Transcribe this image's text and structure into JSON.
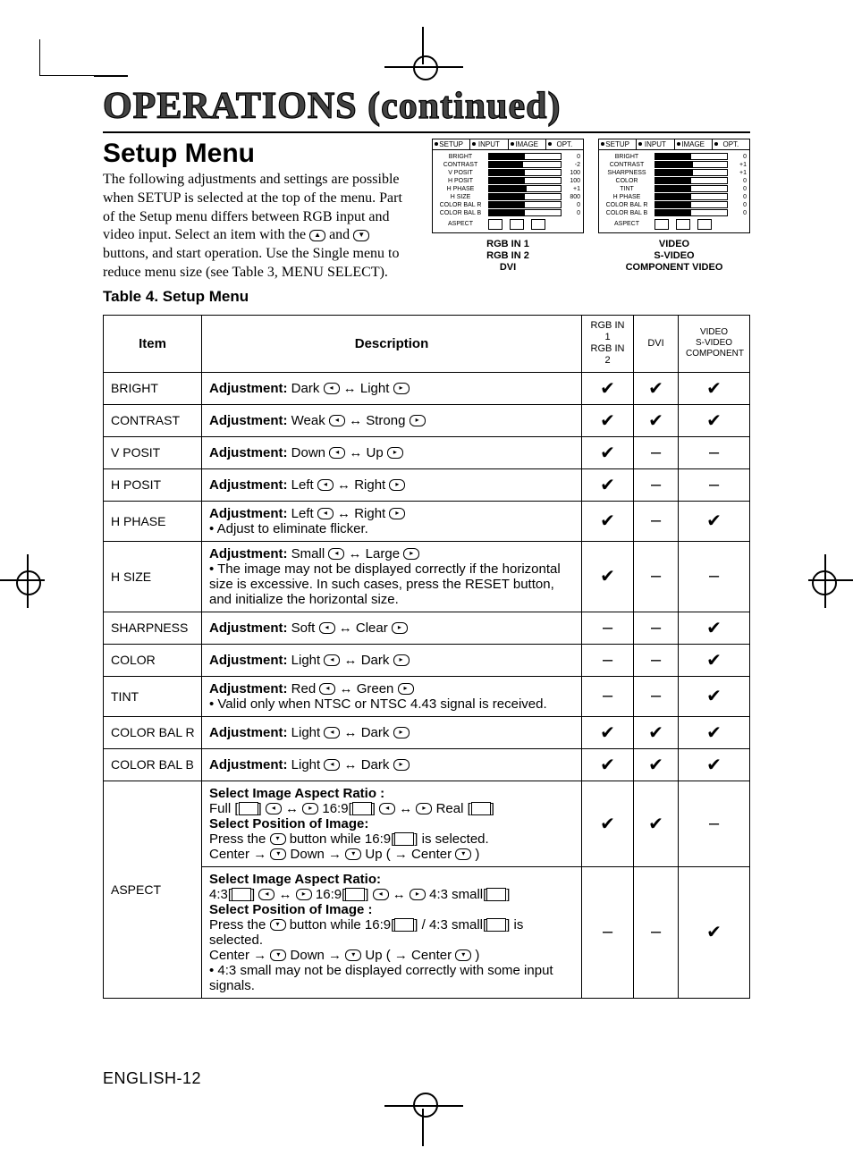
{
  "page_title": "OPERATIONS (continued)",
  "section_title": "Setup Menu",
  "intro": "The following adjustments and settings are possible when SETUP is selected at the top of the menu. Part of the Setup menu differs between RGB input and video input. Select an item with the Ⓐ and Ⓑ buttons, and start operation. Use the Single menu to reduce menu size (see Table 3, MENU SELECT).",
  "intro_pre": "The following adjustments and settings are possible when SETUP is selected at the top of the menu. Part of the Setup menu differs between RGB input and video input. Select an item with the ",
  "intro_mid": " and ",
  "intro_post": " buttons, and start operation. Use the Single menu to reduce menu size (see Table 3, MENU SELECT).",
  "table_caption": "Table 4. Setup Menu",
  "osd_tabs": [
    "SETUP",
    "INPUT",
    "IMAGE",
    "OPT."
  ],
  "osd_rgb": {
    "rows": [
      {
        "label": "BRIGHT",
        "fill": 50,
        "val": "0"
      },
      {
        "label": "CONTRAST",
        "fill": 48,
        "val": "-2"
      },
      {
        "label": "V POSIT",
        "fill": 50,
        "val": "100"
      },
      {
        "label": "H POSIT",
        "fill": 50,
        "val": "100"
      },
      {
        "label": "H PHASE",
        "fill": 52,
        "val": "+1"
      },
      {
        "label": "H SIZE",
        "fill": 50,
        "val": "800"
      },
      {
        "label": "COLOR BAL R",
        "fill": 50,
        "val": "0"
      },
      {
        "label": "COLOR BAL B",
        "fill": 50,
        "val": "0"
      }
    ],
    "aspect": "ASPECT",
    "caption": "RGB IN 1\nRGB IN 2\nDVI"
  },
  "osd_vid": {
    "rows": [
      {
        "label": "BRIGHT",
        "fill": 50,
        "val": "0"
      },
      {
        "label": "CONTRAST",
        "fill": 52,
        "val": "+1"
      },
      {
        "label": "SHARPNESS",
        "fill": 52,
        "val": "+1"
      },
      {
        "label": "COLOR",
        "fill": 50,
        "val": "0"
      },
      {
        "label": "TINT",
        "fill": 50,
        "val": "0"
      },
      {
        "label": "H PHASE",
        "fill": 50,
        "val": "0"
      },
      {
        "label": "COLOR BAL  R",
        "fill": 50,
        "val": "0"
      },
      {
        "label": "COLOR BAL  B",
        "fill": 50,
        "val": "0"
      }
    ],
    "aspect": "ASPECT",
    "caption": "VIDEO\nS-VIDEO\nCOMPONENT VIDEO"
  },
  "headers": {
    "item": "Item",
    "desc": "Description",
    "c1": "RGB IN 1\nRGB IN 2",
    "c2": "DVI",
    "c3": "VIDEO\nS-VIDEO\nCOMPONENT"
  },
  "rows": [
    {
      "item": "BRIGHT",
      "desc_b": "Adjustment:",
      "desc": " Dark ⓜ ↔ Light ⓞ",
      "c": [
        "✔",
        "✔",
        "✔"
      ]
    },
    {
      "item": "CONTRAST",
      "desc_b": "Adjustment:",
      "desc": " Weak ⓜ ↔ Strong ⓞ",
      "c": [
        "✔",
        "✔",
        "✔"
      ]
    },
    {
      "item": "V POSIT",
      "desc_b": "Adjustment:",
      "desc": " Down ⓜ ↔ Up ⓞ",
      "c": [
        "✔",
        "–",
        "–"
      ]
    },
    {
      "item": "H POSIT",
      "desc_b": "Adjustment:",
      "desc": " Left ⓜ ↔ Right ⓞ",
      "c": [
        "✔",
        "–",
        "–"
      ]
    },
    {
      "item": "H PHASE",
      "desc_b": "Adjustment:",
      "desc": " Left ⓜ ↔ Right ⓞ",
      "note": "• Adjust to eliminate flicker.",
      "c": [
        "✔",
        "–",
        "✔"
      ]
    },
    {
      "item": "H SIZE",
      "desc_b": "Adjustment:",
      "desc": " Small ⓜ ↔ Large ⓞ",
      "note": "• The image may not be displayed correctly if the horizontal size is excessive. In such cases, press the RESET button, and initialize the horizontal size.",
      "c": [
        "✔",
        "–",
        "–"
      ]
    },
    {
      "item": "SHARPNESS",
      "desc_b": "Adjustment:",
      "desc": " Soft ⓜ ↔ Clear ⓞ",
      "c": [
        "–",
        "–",
        "✔"
      ]
    },
    {
      "item": "COLOR",
      "desc_b": "Adjustment:",
      "desc": " Light ⓜ ↔ Dark ⓞ",
      "c": [
        "–",
        "–",
        "✔"
      ]
    },
    {
      "item": "TINT",
      "desc_b": "Adjustment:",
      "desc": " Red ⓜ ↔ Green ⓞ",
      "note": "• Valid only when NTSC or NTSC 4.43 signal is received.",
      "c": [
        "–",
        "–",
        "✔"
      ]
    },
    {
      "item": "COLOR BAL R",
      "desc_b": "Adjustment:",
      "desc": " Light ⓜ ↔ Dark ⓞ",
      "c": [
        "✔",
        "✔",
        "✔"
      ]
    },
    {
      "item": "COLOR BAL B",
      "desc_b": "Adjustment:",
      "desc": " Light ⓜ ↔ Dark ⓞ",
      "c": [
        "✔",
        "✔",
        "✔"
      ]
    }
  ],
  "aspect": {
    "item": "ASPECT",
    "row1": {
      "l1": "Select Image Aspect Ratio :",
      "l2": "Full [▭] ⓜ ↔ ⓞ 16:9[▭]  ⓜ ↔ ⓞ Real [▭]",
      "l3": "Select Position of Image:",
      "l4": "Press the Ⓑ button while 16:9[▭] is selected.",
      "l5": "Center → Ⓑ Down → Ⓑ Up ( → Center Ⓑ )",
      "c": [
        "✔",
        "✔",
        "–"
      ]
    },
    "row2": {
      "l1": "Select Image Aspect Ratio:",
      "l2": "4:3[▭] ⓜ ↔ ⓞ 16:9[▭] ⓜ ↔ ⓞ 4:3 small[▭]",
      "l3": "Select Position of Image :",
      "l4": "Press the Ⓑ button while 16:9[▭] / 4:3 small[▭] is selected.",
      "l5": "Center → Ⓑ Down → Ⓑ Up ( → Center Ⓑ )",
      "l6": "• 4:3 small may not be displayed correctly with some input signals.",
      "c": [
        "–",
        "–",
        "✔"
      ]
    }
  },
  "footer": "ENGLISH-12"
}
